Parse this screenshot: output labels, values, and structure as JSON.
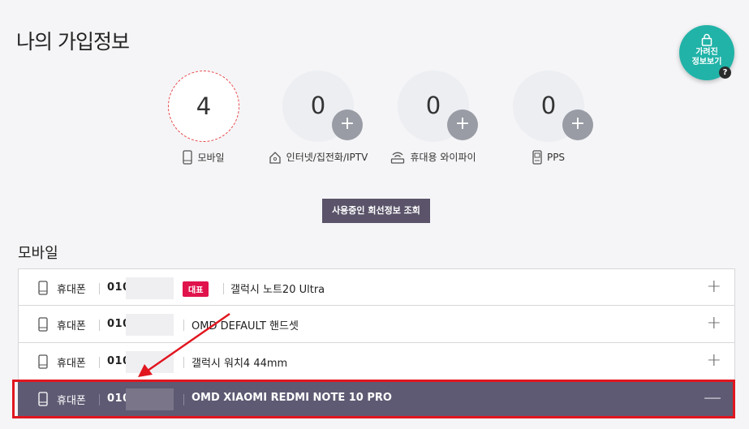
{
  "page": {
    "title": "나의 가입정보"
  },
  "hidden_info_button": {
    "label": "가려진\n정보보기",
    "help": "?"
  },
  "services": [
    {
      "count": "4",
      "label": "모바일",
      "icon": "mobile-icon",
      "active": true
    },
    {
      "count": "0",
      "label": "인터넷/집전화/IPTV",
      "icon": "home-icon",
      "add": "+"
    },
    {
      "count": "0",
      "label": "휴대용 와이파이",
      "icon": "wifi-router-icon",
      "add": "+"
    },
    {
      "count": "0",
      "label": "PPS",
      "icon": "pps-phone-icon",
      "add": "+"
    }
  ],
  "lookup_button": "사용중인 회선정보 조회",
  "mobile_section": {
    "title": "모바일",
    "lines": [
      {
        "kind": "휴대폰",
        "number": "010-",
        "badge": "대표",
        "model": "갤럭시 노트20 Ultra",
        "toggle": "+"
      },
      {
        "kind": "휴대폰",
        "number": "010-",
        "model": "OMD DEFAULT 핸드셋",
        "toggle": "+"
      },
      {
        "kind": "휴대폰",
        "number": "010-",
        "model": "갤럭시 워치4 44mm",
        "toggle": "+"
      },
      {
        "kind": "휴대폰",
        "number": "010-",
        "model": "OMD XIAOMI REDMI NOTE 10 PRO",
        "toggle": "—",
        "selected": true
      }
    ]
  },
  "colors": {
    "accent_teal": "#21b3a8",
    "selected_row": "#5f5a73",
    "badge_red": "#e0134c",
    "annotation_red": "#e1161f"
  }
}
